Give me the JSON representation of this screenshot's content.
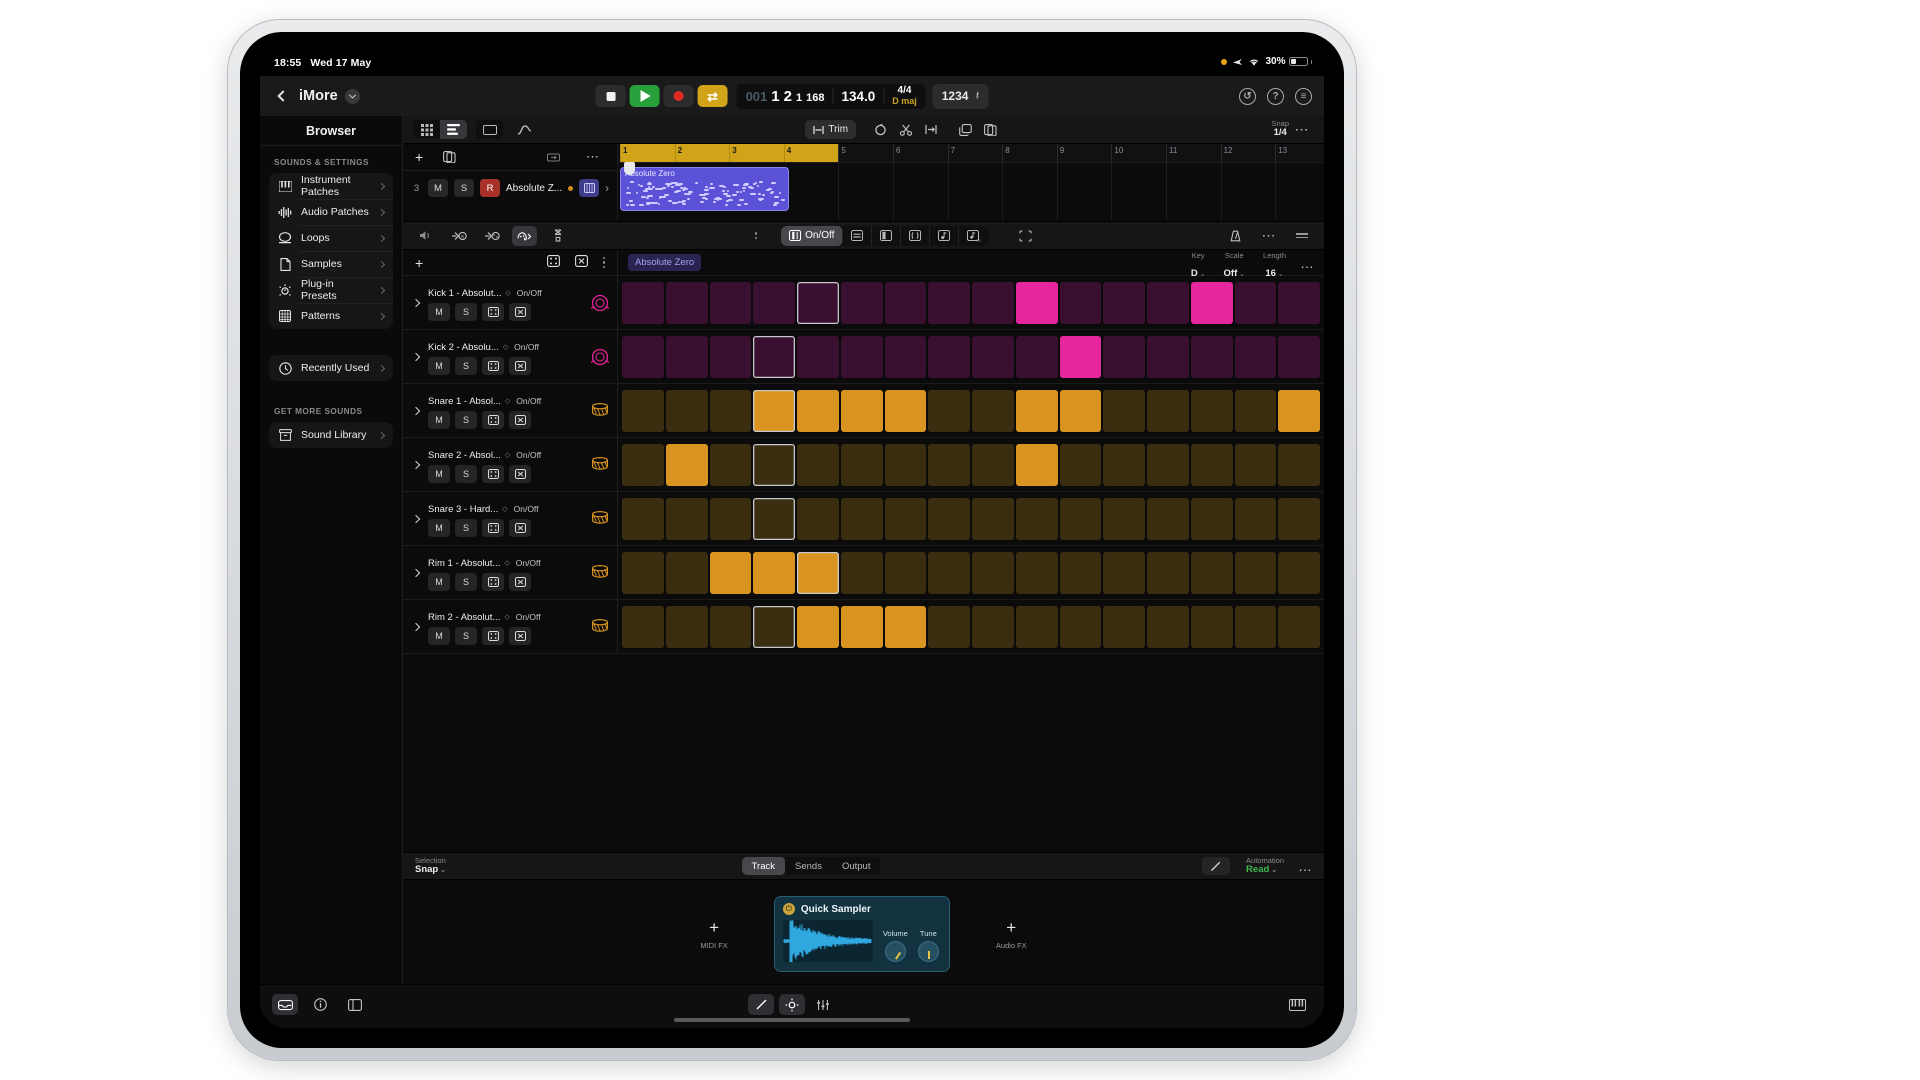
{
  "status": {
    "time": "18:55",
    "date": "Wed 17 May",
    "battery": "30%"
  },
  "nav": {
    "back": "‹",
    "project": "iMore",
    "menu_chevron": "chevron-down"
  },
  "transport": {
    "stop": "Stop",
    "play": "Play",
    "record": "Record",
    "cycle": "Cycle",
    "position": {
      "bar_dim": "001",
      "bar": "1",
      "beat": "2",
      "div": "1",
      "ticks": "168"
    },
    "tempo": "134.0",
    "signature": "4/4",
    "key": "D maj",
    "count_in": "1234",
    "metronome": "metronome-icon"
  },
  "nav_right": {
    "undo": "↺",
    "help": "?",
    "settings": "⊜"
  },
  "browser": {
    "title": "Browser",
    "section1": "SOUNDS & SETTINGS",
    "items": [
      {
        "label": "Instrument Patches",
        "icon": "piano-keys-icon"
      },
      {
        "label": "Audio Patches",
        "icon": "waveform-icon"
      },
      {
        "label": "Loops",
        "icon": "loop-icon"
      },
      {
        "label": "Samples",
        "icon": "document-icon"
      },
      {
        "label": "Plug-in Presets",
        "icon": "knob-icon"
      },
      {
        "label": "Patterns",
        "icon": "grid-icon"
      }
    ],
    "recent": {
      "label": "Recently Used",
      "icon": "clock-icon"
    },
    "section2": "GET MORE SOUNDS",
    "library": {
      "label": "Sound Library",
      "icon": "archive-icon"
    }
  },
  "toolbar": {
    "view_grid": "grid-view-icon",
    "view_list": "list-view-icon",
    "view_single": "single-view-icon",
    "automation": "automation-curve-icon",
    "trim": "Trim",
    "loop": "loop-tool-icon",
    "scissors": "scissors-icon",
    "flex": "flex-icon",
    "copy": "copy-icon",
    "duplicate": "duplicate-icon",
    "snap_label": "Snap",
    "snap_value": "1/4",
    "more": "more-icon"
  },
  "track": {
    "number": "3",
    "mute": "M",
    "solo": "S",
    "record": "R",
    "name": "Absolute Z...",
    "quantize": "quantize-icon",
    "chevron": "›",
    "add": "+",
    "duplicate": "duplicate-icon",
    "more": "…",
    "monitor": "monitor-icon"
  },
  "ruler": {
    "bars": [
      "1",
      "2",
      "3",
      "4",
      "5",
      "6",
      "7",
      "8",
      "9",
      "10",
      "11",
      "12",
      "13"
    ],
    "cycle_bars": [
      "1",
      "2",
      "3",
      "4"
    ]
  },
  "region": {
    "name": "Absolute Zero"
  },
  "seqbar": {
    "speaker": "speaker-icon",
    "rec_note": "record-note-icon",
    "rand_note": "random-note-icon",
    "pattern_brain": "pattern-icon",
    "steps": "steps-icon",
    "mode": "On/Off",
    "edit_rows": "rows-icon",
    "edit_half": "half-icon",
    "edit_tie": "tie-icon",
    "edit_note": "note-icon",
    "edit_octave": "octave-icon",
    "select": "select-icon",
    "metronome": "metronome-icon",
    "more": "…",
    "handle": "drag-handle"
  },
  "stephead": {
    "add": "+",
    "randomize": "dice-icon",
    "clear": "clear-icon",
    "more": "⋮",
    "pattern": "Absolute Zero",
    "key_label": "Key",
    "key_value": "D",
    "scale_label": "Scale",
    "scale_value": "Off",
    "length_label": "Length",
    "length_value": "16",
    "more_right": "…"
  },
  "rows": [
    {
      "name": "Kick 1 - Absolut...",
      "onoff": "On/Off",
      "m": "M",
      "s": "S",
      "dice": "dice-icon",
      "clear": "clear-icon",
      "inst": "kick-drum-icon",
      "color": "#3a0f30",
      "accent": "#e6269c",
      "steps": [
        0,
        0,
        0,
        0,
        2,
        0,
        0,
        0,
        0,
        1,
        0,
        0,
        0,
        1,
        0,
        0
      ]
    },
    {
      "name": "Kick 2 - Absolu...",
      "onoff": "On/Off",
      "m": "M",
      "s": "S",
      "dice": "dice-icon",
      "clear": "clear-icon",
      "inst": "kick-drum-icon",
      "color": "#3a0f30",
      "accent": "#e6269c",
      "steps": [
        0,
        0,
        0,
        2,
        0,
        0,
        0,
        0,
        0,
        0,
        1,
        0,
        0,
        0,
        0,
        0
      ]
    },
    {
      "name": "Snare 1 - Absol...",
      "onoff": "On/Off",
      "m": "M",
      "s": "S",
      "dice": "dice-icon",
      "clear": "clear-icon",
      "inst": "snare-drum-icon",
      "color": "#3a2d10",
      "accent": "#d9941f",
      "steps": [
        0,
        0,
        0,
        3,
        1,
        1,
        1,
        0,
        0,
        1,
        1,
        0,
        0,
        0,
        0,
        1
      ]
    },
    {
      "name": "Snare 2 - Absol...",
      "onoff": "On/Off",
      "m": "M",
      "s": "S",
      "dice": "dice-icon",
      "clear": "clear-icon",
      "inst": "snare-drum-icon",
      "color": "#3a2d10",
      "accent": "#d9941f",
      "steps": [
        0,
        1,
        0,
        2,
        0,
        0,
        0,
        0,
        0,
        1,
        0,
        0,
        0,
        0,
        0,
        0
      ]
    },
    {
      "name": "Snare 3 - Hard...",
      "onoff": "On/Off",
      "m": "M",
      "s": "S",
      "dice": "dice-icon",
      "clear": "clear-icon",
      "inst": "snare-drum-icon",
      "color": "#3a2d10",
      "accent": "#d9941f",
      "steps": [
        0,
        0,
        0,
        2,
        0,
        0,
        0,
        0,
        0,
        0,
        0,
        0,
        0,
        0,
        0,
        0
      ]
    },
    {
      "name": "Rim 1 - Absolut...",
      "onoff": "On/Off",
      "m": "M",
      "s": "S",
      "dice": "dice-icon",
      "clear": "clear-icon",
      "inst": "snare-drum-icon",
      "color": "#3a2d10",
      "accent": "#d9941f",
      "steps": [
        0,
        0,
        1,
        1,
        3,
        0,
        0,
        0,
        0,
        0,
        0,
        0,
        0,
        0,
        0,
        0
      ]
    },
    {
      "name": "Rim 2 - Absolut...",
      "onoff": "On/Off",
      "m": "M",
      "s": "S",
      "dice": "dice-icon",
      "clear": "clear-icon",
      "inst": "snare-drum-icon",
      "color": "#3a2d10",
      "accent": "#d9941f",
      "steps": [
        0,
        0,
        0,
        2,
        1,
        1,
        1,
        0,
        0,
        0,
        0,
        0,
        0,
        0,
        0,
        0
      ]
    }
  ],
  "inspector": {
    "selection_label": "Selection",
    "selection_value": "Snap",
    "tabs": [
      "Track",
      "Sends",
      "Output"
    ],
    "active_tab": "Track",
    "pencil": "pencil-icon",
    "automation_label": "Automation",
    "automation_value": "Read",
    "more": "…"
  },
  "plugins": {
    "midi_fx": {
      "plus": "+",
      "label": "MIDI FX"
    },
    "audio_fx": {
      "plus": "+",
      "label": "Audio FX"
    },
    "card": {
      "title": "Quick Sampler",
      "power": "⏻",
      "knobs": [
        {
          "label": "Volume"
        },
        {
          "label": "Tune"
        }
      ]
    }
  },
  "bottombar": {
    "left": [
      "browser-toggle-icon",
      "info-icon",
      "panel-icon"
    ],
    "center": [
      "pencil-tool-icon",
      "brightness-icon",
      "mixer-icon"
    ],
    "right": "keyboard-icon"
  },
  "colors": {
    "play_green": "#28a03c",
    "record_red": "#e02b20",
    "cycle_yellow": "#d1a318",
    "region_purple": "#5b52d8",
    "kick_pink": "#e6269c",
    "snare_orange": "#d9941f"
  }
}
